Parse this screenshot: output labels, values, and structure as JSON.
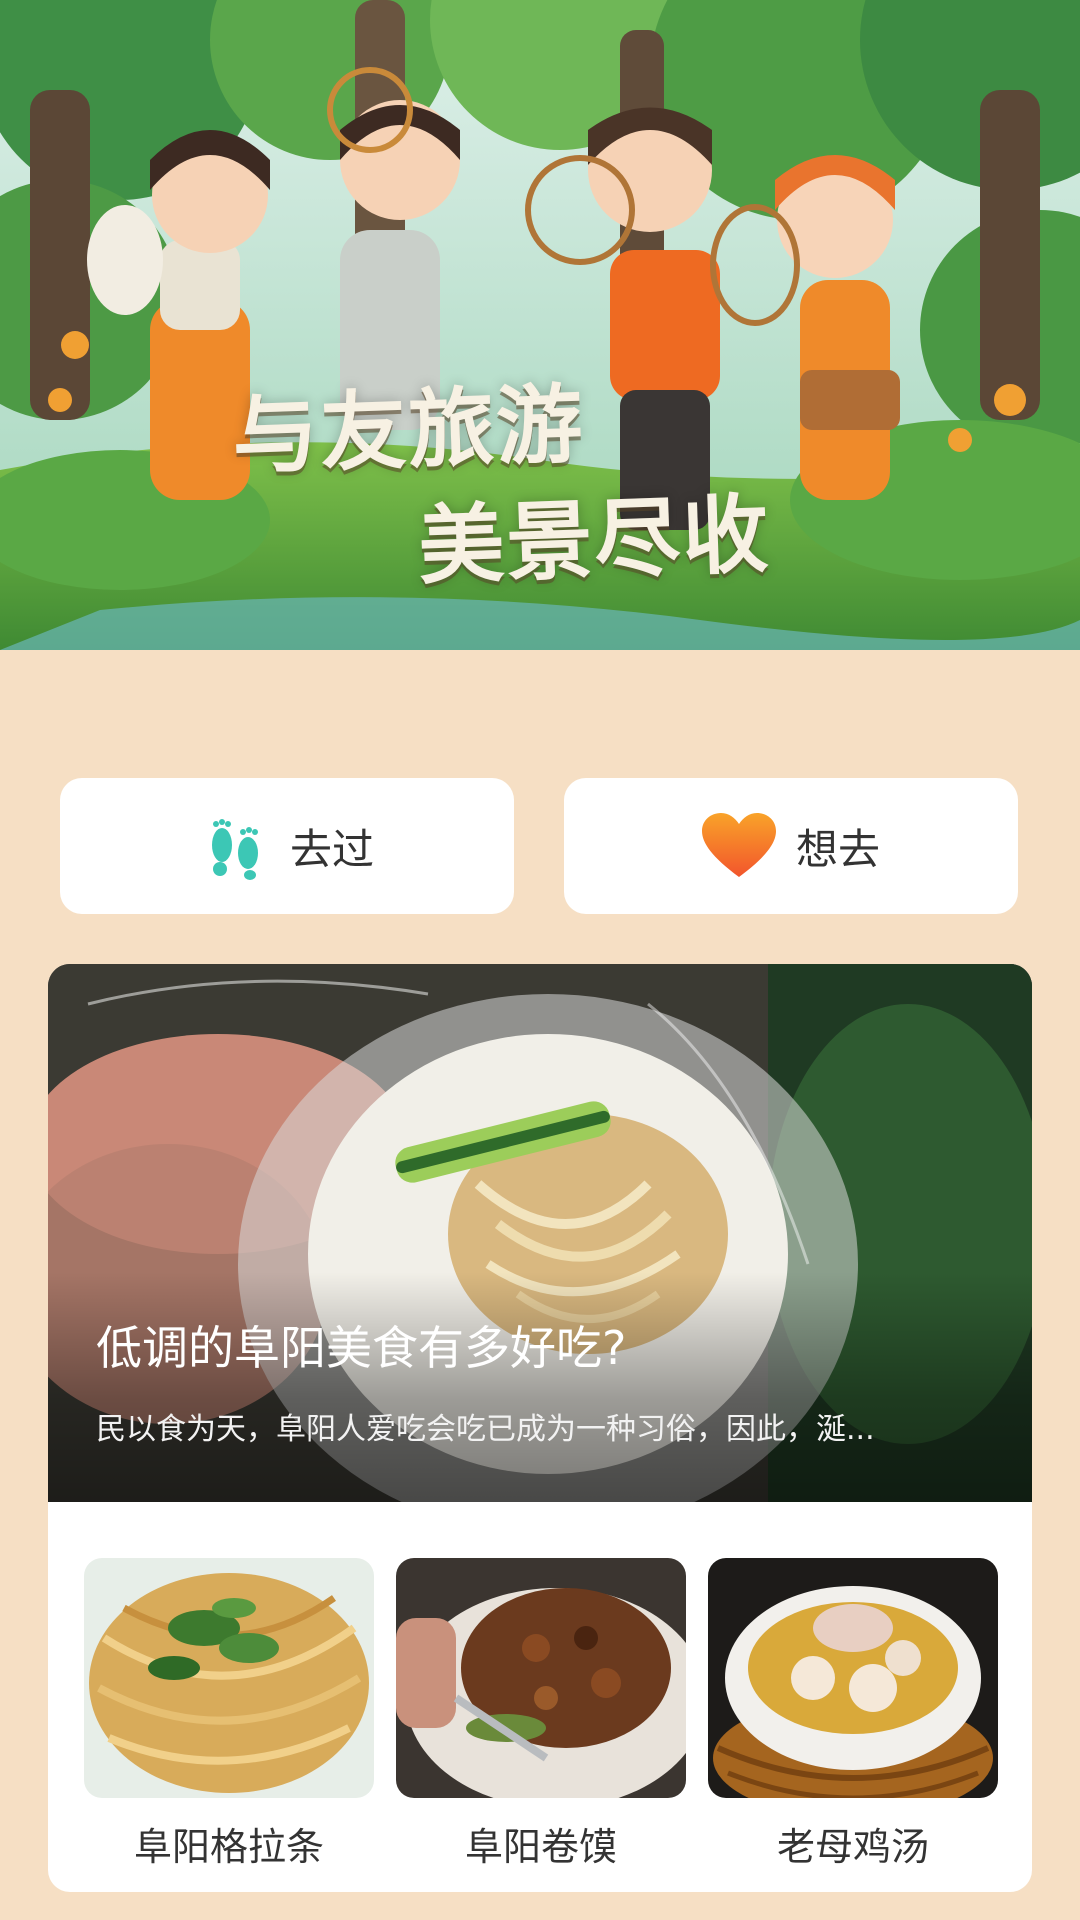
{
  "hero": {
    "line1": "与友旅游",
    "line2": "美景尽收"
  },
  "actions": {
    "been": {
      "label": "去过",
      "icon": "footprints-icon",
      "color": "#3cc7b5"
    },
    "want": {
      "label": "想去",
      "icon": "heart-icon",
      "color": "#f7692c"
    }
  },
  "feature": {
    "title": "低调的阜阳美食有多好吃?",
    "description": "民以食为天，阜阳人爱吃会吃已成为一种习俗，因此，涎..."
  },
  "dishes": [
    {
      "name": "阜阳格拉条"
    },
    {
      "name": "阜阳卷馍"
    },
    {
      "name": "老母鸡汤"
    }
  ]
}
